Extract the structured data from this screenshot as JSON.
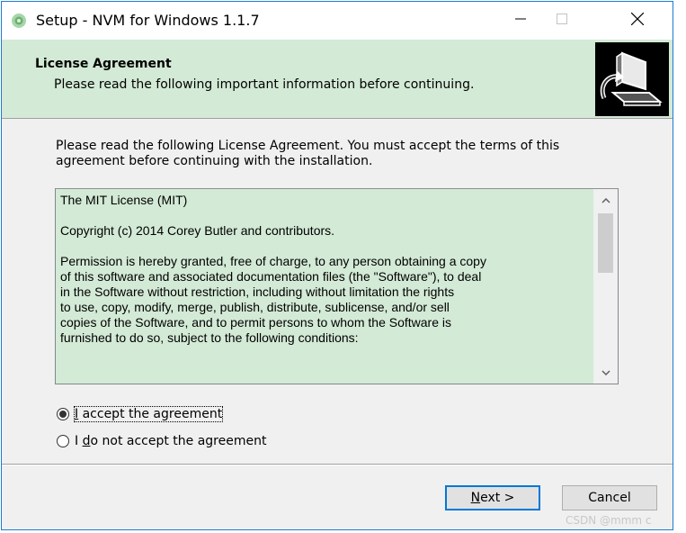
{
  "window": {
    "title": "Setup - NVM for Windows 1.1.7",
    "minimize_icon": "minimize-icon",
    "maximize_icon": "maximize-icon",
    "close_icon": "close-icon"
  },
  "header": {
    "title": "License Agreement",
    "subtitle": "Please read the following important information before continuing.",
    "image_icon": "computer-setup-icon"
  },
  "main": {
    "intro": "Please read the following License Agreement. You must accept the terms of this agreement before continuing with the installation.",
    "license_paragraphs": [
      "The MIT License (MIT)",
      "Copyright (c) 2014 Corey Butler and contributors.",
      "Permission is hereby granted, free of charge, to any person obtaining a copy\nof this software and associated documentation files (the \"Software\"), to deal\nin the Software without restriction, including without limitation the rights\nto use, copy, modify, merge, publish, distribute, sublicense, and/or sell\ncopies of the Software, and to permit persons to whom the Software is\nfurnished to do so, subject to the following conditions:"
    ],
    "options": {
      "accept": {
        "label_pre": "",
        "mnemonic": "I",
        "label_post": " accept the agreement",
        "selected": true
      },
      "decline": {
        "label_pre": "I ",
        "mnemonic": "d",
        "label_post": "o not accept the agreement",
        "selected": false
      }
    }
  },
  "footer": {
    "next": {
      "mnemonic": "N",
      "rest": "ext >"
    },
    "cancel": "Cancel"
  },
  "watermark": "CSDN @mmm c",
  "colors": {
    "header_bg": "#d3ead6",
    "license_bg": "#d3ead6",
    "accent": "#0078d7",
    "window_border": "#1e7bd4"
  }
}
